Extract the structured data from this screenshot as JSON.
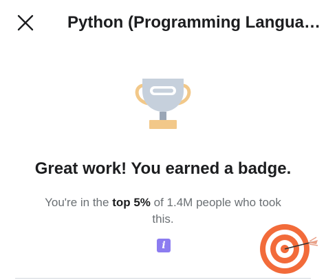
{
  "header": {
    "close_icon": "close-icon",
    "title": "Python (Programming Langua…"
  },
  "badge": {
    "icon": "trophy-icon",
    "headline": "Great work! You earned a badge.",
    "message_prefix": "You're in the ",
    "message_bold": "top 5%",
    "message_suffix": " of 1.4M people who took this."
  },
  "info": {
    "icon": "info-icon",
    "glyph": "i"
  },
  "decoration": {
    "icon": "target-icon"
  },
  "colors": {
    "accent_purple": "#8c7cf0",
    "target_orange": "#f26b3a",
    "trophy_silver": "#c6d0dc",
    "trophy_gold": "#f2c889"
  }
}
